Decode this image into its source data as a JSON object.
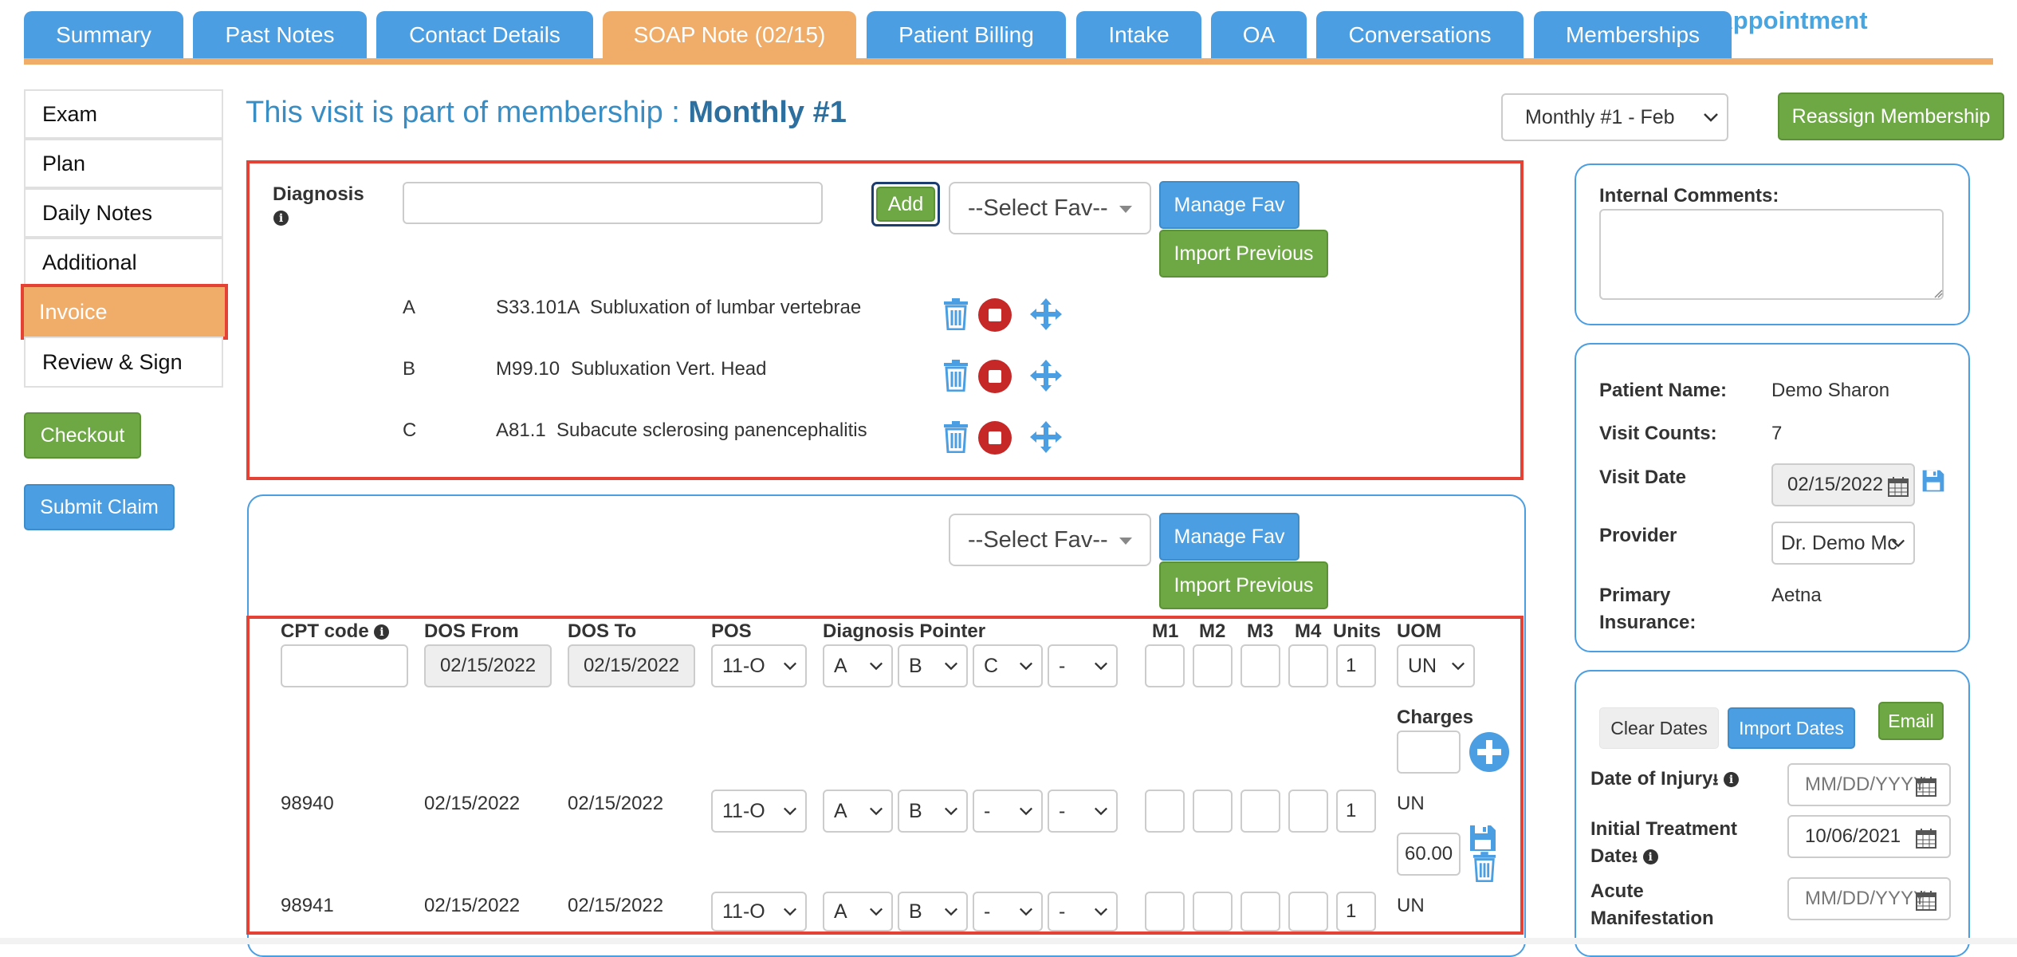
{
  "header": {
    "behind_title": "d Appointment",
    "tabs": [
      {
        "label": "Summary"
      },
      {
        "label": "Past Notes"
      },
      {
        "label": "Contact Details"
      },
      {
        "label": "SOAP Note (02/15)"
      },
      {
        "label": "Patient Billing"
      },
      {
        "label": "Intake"
      },
      {
        "label": "OA"
      },
      {
        "label": "Conversations"
      },
      {
        "label": "Memberships"
      }
    ],
    "active_tab": "SOAP Note (02/15)"
  },
  "sidebar": {
    "items": [
      {
        "label": "Exam"
      },
      {
        "label": "Plan"
      },
      {
        "label": "Daily Notes"
      },
      {
        "label": "Additional"
      },
      {
        "label": "Invoice"
      },
      {
        "label": "Review & Sign"
      }
    ],
    "active_item": "Invoice",
    "checkout_label": "Checkout",
    "submit_claim_label": "Submit Claim"
  },
  "membership": {
    "heading_prefix": "This visit is part of membership : ",
    "heading_name": "Monthly #1",
    "selected_period": "Monthly #1 - Feb",
    "reassign_label": "Reassign Membership"
  },
  "diagnosis": {
    "label": "Diagnosis",
    "input_value": "",
    "add_label": "Add",
    "fav_placeholder": "--Select Fav--",
    "manage_fav_label": "Manage Fav",
    "import_previous_label": "Import Previous",
    "items": [
      {
        "letter": "A",
        "code": "S33.101A",
        "description": "Subluxation of lumbar vertebrae"
      },
      {
        "letter": "B",
        "code": "M99.10",
        "description": "Subluxation Vert. Head"
      },
      {
        "letter": "C",
        "code": "A81.1",
        "description": "Subacute sclerosing panencephalitis"
      }
    ]
  },
  "procedures": {
    "fav_placeholder": "--Select Fav--",
    "manage_fav_label": "Manage Fav",
    "import_previous_label": "Import Previous",
    "headers": {
      "cpt": "CPT code",
      "dos_from": "DOS From",
      "dos_to": "DOS To",
      "pos": "POS",
      "pointer": "Diagnosis Pointer",
      "m1": "M1",
      "m2": "M2",
      "m3": "M3",
      "m4": "M4",
      "units": "Units",
      "uom": "UOM",
      "charges": "Charges"
    },
    "new_row": {
      "cpt": "",
      "dos_from": "02/15/2022",
      "dos_to": "02/15/2022",
      "pos": "11-O",
      "pointers": [
        "A",
        "B",
        "C",
        "-"
      ],
      "units": "1",
      "uom": "UN",
      "charges": ""
    },
    "rows": [
      {
        "cpt": "98940",
        "dos_from": "02/15/2022",
        "dos_to": "02/15/2022",
        "pos": "11-O",
        "pointers": [
          "A",
          "B",
          "-",
          "-"
        ],
        "units": "1",
        "uom": "UN",
        "charge": "60.00"
      },
      {
        "cpt": "98941",
        "dos_from": "02/15/2022",
        "dos_to": "02/15/2022",
        "pos": "11-O",
        "pointers": [
          "A",
          "B",
          "-",
          "-"
        ],
        "units": "1",
        "uom": "UN"
      }
    ]
  },
  "right_panel": {
    "internal_comments_label": "Internal Comments:",
    "internal_comments_value": "",
    "patient_name_label": "Patient Name:",
    "patient_name": "Demo Sharon",
    "visit_counts_label": "Visit Counts:",
    "visit_counts": "7",
    "visit_date_label": "Visit Date",
    "visit_date": "02/15/2022",
    "provider_label": "Provider",
    "provider": "Dr. Demo Mc",
    "primary_insurance_label_1": "Primary",
    "primary_insurance_label_2": "Insurance:",
    "primary_insurance": "Aetna",
    "clear_dates_label": "Clear Dates",
    "import_dates_label": "Import Dates",
    "email_label": "Email",
    "date_of_injury_label": "Date of Injury",
    "date_of_injury_placeholder": "MM/DD/YYYY",
    "initial_treatment_label_1": "Initial Treatment",
    "initial_treatment_label_2": "Date",
    "initial_treatment_date": "10/06/2021",
    "acute_label_1": "Acute",
    "acute_label_2": "Manifestation",
    "acute_placeholder": "MM/DD/YYYY"
  },
  "colors": {
    "tab_blue": "#4a9ee1",
    "tab_active": "#f0ad6a",
    "highlight_red": "#e34234",
    "button_green": "#6ea845",
    "heading_blue": "#3a8dc2"
  }
}
